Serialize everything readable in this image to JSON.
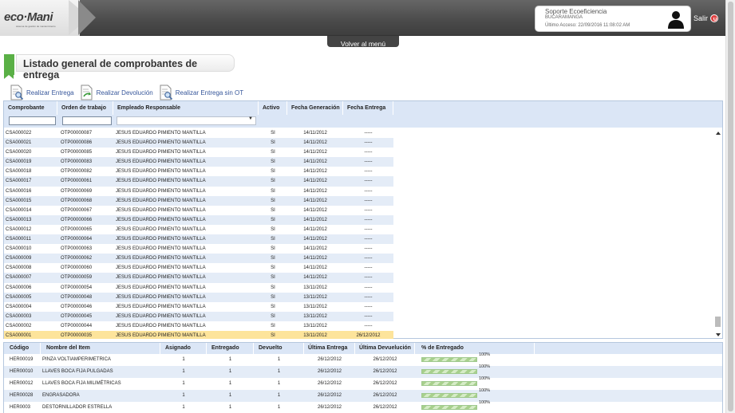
{
  "header": {
    "logo_text": "eco·Mani",
    "logo_tagline": "sistema de gestión de mantenimiento",
    "user_name": "Soporte Ecoeficiencia",
    "user_city": "BUCARAMANGA",
    "last_access": "Último Acceso: 22/09/2016 11:08:02 AM",
    "salir_label": "Salir",
    "volver_label": "Volver al menú"
  },
  "page": {
    "title": "Listado general de comprobantes de entrega"
  },
  "actions": [
    {
      "label": "Realizar Entrega",
      "icon": "document-search-icon"
    },
    {
      "label": "Realizar Devolución",
      "icon": "document-return-icon"
    },
    {
      "label": "Realizar Entrega sin OT",
      "icon": "document-search-icon"
    }
  ],
  "grid": {
    "columns": [
      "Comprobante",
      "Orden de trabajo",
      "Empleado Responsable",
      "Activo",
      "Fecha Generación",
      "Fecha Entrega"
    ],
    "rows": [
      [
        "CSA000022",
        "OTP00000087",
        "JESUS EDUARDO PIMIENTO MANTILLA",
        "SI",
        "14/11/2012",
        "-----"
      ],
      [
        "CSA000021",
        "OTP00000086",
        "JESUS EDUARDO PIMIENTO MANTILLA",
        "SI",
        "14/11/2012",
        "-----"
      ],
      [
        "CSA000020",
        "OTP00000085",
        "JESUS EDUARDO PIMIENTO MANTILLA",
        "SI",
        "14/11/2012",
        "-----"
      ],
      [
        "CSA000019",
        "OTP00000083",
        "JESUS EDUARDO PIMIENTO MANTILLA",
        "SI",
        "14/11/2012",
        "-----"
      ],
      [
        "CSA000018",
        "OTP00000082",
        "JESUS EDUARDO PIMIENTO MANTILLA",
        "SI",
        "14/11/2012",
        "-----"
      ],
      [
        "CSA000017",
        "OTP00000061",
        "JESUS EDUARDO PIMIENTO MANTILLA",
        "SI",
        "14/11/2012",
        "-----"
      ],
      [
        "CSA000016",
        "OTP00000069",
        "JESUS EDUARDO PIMIENTO MANTILLA",
        "SI",
        "14/11/2012",
        "-----"
      ],
      [
        "CSA000015",
        "OTP00000068",
        "JESUS EDUARDO PIMIENTO MANTILLA",
        "SI",
        "14/11/2012",
        "-----"
      ],
      [
        "CSA000014",
        "OTP00000067",
        "JESUS EDUARDO PIMIENTO MANTILLA",
        "SI",
        "14/11/2012",
        "-----"
      ],
      [
        "CSA000013",
        "OTP00000066",
        "JESUS EDUARDO PIMIENTO MANTILLA",
        "SI",
        "14/11/2012",
        "-----"
      ],
      [
        "CSA000012",
        "OTP00000065",
        "JESUS EDUARDO PIMIENTO MANTILLA",
        "SI",
        "14/11/2012",
        "-----"
      ],
      [
        "CSA000011",
        "OTP00000064",
        "JESUS EDUARDO PIMIENTO MANTILLA",
        "SI",
        "14/11/2012",
        "-----"
      ],
      [
        "CSA000010",
        "OTP00000063",
        "JESUS EDUARDO PIMIENTO MANTILLA",
        "SI",
        "14/11/2012",
        "-----"
      ],
      [
        "CSA000009",
        "OTP00000062",
        "JESUS EDUARDO PIMIENTO MANTILLA",
        "SI",
        "14/11/2012",
        "-----"
      ],
      [
        "CSA000008",
        "OTP00000060",
        "JESUS EDUARDO PIMIENTO MANTILLA",
        "SI",
        "14/11/2012",
        "-----"
      ],
      [
        "CSA000007",
        "OTP00000059",
        "JESUS EDUARDO PIMIENTO MANTILLA",
        "SI",
        "14/11/2012",
        "-----"
      ],
      [
        "CSA000006",
        "OTP00000054",
        "JESUS EDUARDO PIMIENTO MANTILLA",
        "SI",
        "13/11/2012",
        "-----"
      ],
      [
        "CSA000005",
        "OTP00000048",
        "JESUS EDUARDO PIMIENTO MANTILLA",
        "SI",
        "13/11/2012",
        "-----"
      ],
      [
        "CSA000004",
        "OTP00000046",
        "JESUS EDUARDO PIMIENTO MANTILLA",
        "SI",
        "13/11/2012",
        "-----"
      ],
      [
        "CSA000003",
        "OTP00000045",
        "JESUS EDUARDO PIMIENTO MANTILLA",
        "SI",
        "13/11/2012",
        "-----"
      ],
      [
        "CSA000002",
        "OTP00000044",
        "JESUS EDUARDO PIMIENTO MANTILLA",
        "SI",
        "13/11/2012",
        "-----"
      ],
      [
        "CSA000001",
        "OTP00000035",
        "JESUS EDUARDO PIMIENTO MANTILLA",
        "SI",
        "13/11/2012",
        "26/12/2012"
      ]
    ],
    "selected_row": 21
  },
  "detail": {
    "columns": [
      "Código",
      "Nombre del Item",
      "Asignado",
      "Entregado",
      "Devuelto",
      "Última Entrega",
      "Última Devuelución",
      "% de Entregado"
    ],
    "rows": [
      [
        "HER00019",
        "PINZA VOLTIAMPERIMETRICA",
        "1",
        "1",
        "1",
        "26/12/2012",
        "26/12/2012",
        "100%"
      ],
      [
        "HER00010",
        "LLAVES BOCA FIJA PULGADAS",
        "1",
        "1",
        "1",
        "26/12/2012",
        "26/12/2012",
        "100%"
      ],
      [
        "HER00012",
        "LLAVES BOCA FIJA MILIMÉTRICAS",
        "1",
        "1",
        "1",
        "26/12/2012",
        "26/12/2012",
        "100%"
      ],
      [
        "HER00028",
        "ENGRASADORA",
        "1",
        "1",
        "1",
        "26/12/2012",
        "26/12/2012",
        "100%"
      ],
      [
        "HER0003",
        "DESTORNILLADOR ESTRELLA",
        "1",
        "1",
        "1",
        "26/12/2012",
        "26/12/2012",
        "100%"
      ]
    ],
    "progress": [
      1,
      1,
      1,
      1,
      1
    ]
  },
  "colors": {
    "accent_green": "#5ab046",
    "header_blue": "#dbe6f6",
    "row_alt": "#e4ecf7",
    "row_selected": "#fde49b",
    "link_blue": "#36569a"
  }
}
